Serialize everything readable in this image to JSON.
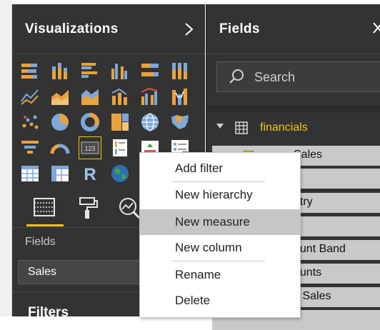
{
  "visualizations": {
    "title": "Visualizations",
    "expand_icon": "chevron-right-icon",
    "icons": [
      "stacked-bar-chart",
      "stacked-column-chart",
      "clustered-bar-chart",
      "clustered-column-chart",
      "100-stacked-bar-chart",
      "100-stacked-column-chart",
      "line-chart",
      "area-chart",
      "stacked-area-chart",
      "line-and-stacked-column-chart",
      "line-and-clustered-column-chart",
      "ribbon-chart",
      "scatter-chart",
      "pie-chart",
      "donut-chart",
      "treemap",
      "map",
      "filled-map",
      "funnel",
      "gauge",
      "card",
      "multi-row-card",
      "kpi",
      "slicer",
      "table",
      "matrix",
      "r-script-visual",
      "globe-map"
    ],
    "tabs": [
      "fields-tab",
      "format-tab",
      "analytics-tab"
    ],
    "fields_label": "Fields",
    "fields_well_value": "Sales",
    "filters_title": "Filters"
  },
  "fields": {
    "title": "Fields",
    "close_icon": "close-icon",
    "search_placeholder": "Search",
    "table_name": "financials",
    "rows": [
      "Sales",
      "S",
      "ntry",
      "",
      "ount Band",
      "ounts",
      "s Sales",
      ""
    ]
  },
  "context_menu": {
    "items": [
      "Add filter",
      "New hierarchy",
      "New measure",
      "New column",
      "Rename",
      "Delete"
    ],
    "highlighted": "New measure"
  },
  "colors": {
    "pane_bg": "#333333",
    "accent_yellow": "#f2c811",
    "icon_orange": "#e8a33c",
    "icon_blue": "#7fa7d9",
    "menu_highlight": "#c6c6c6"
  }
}
